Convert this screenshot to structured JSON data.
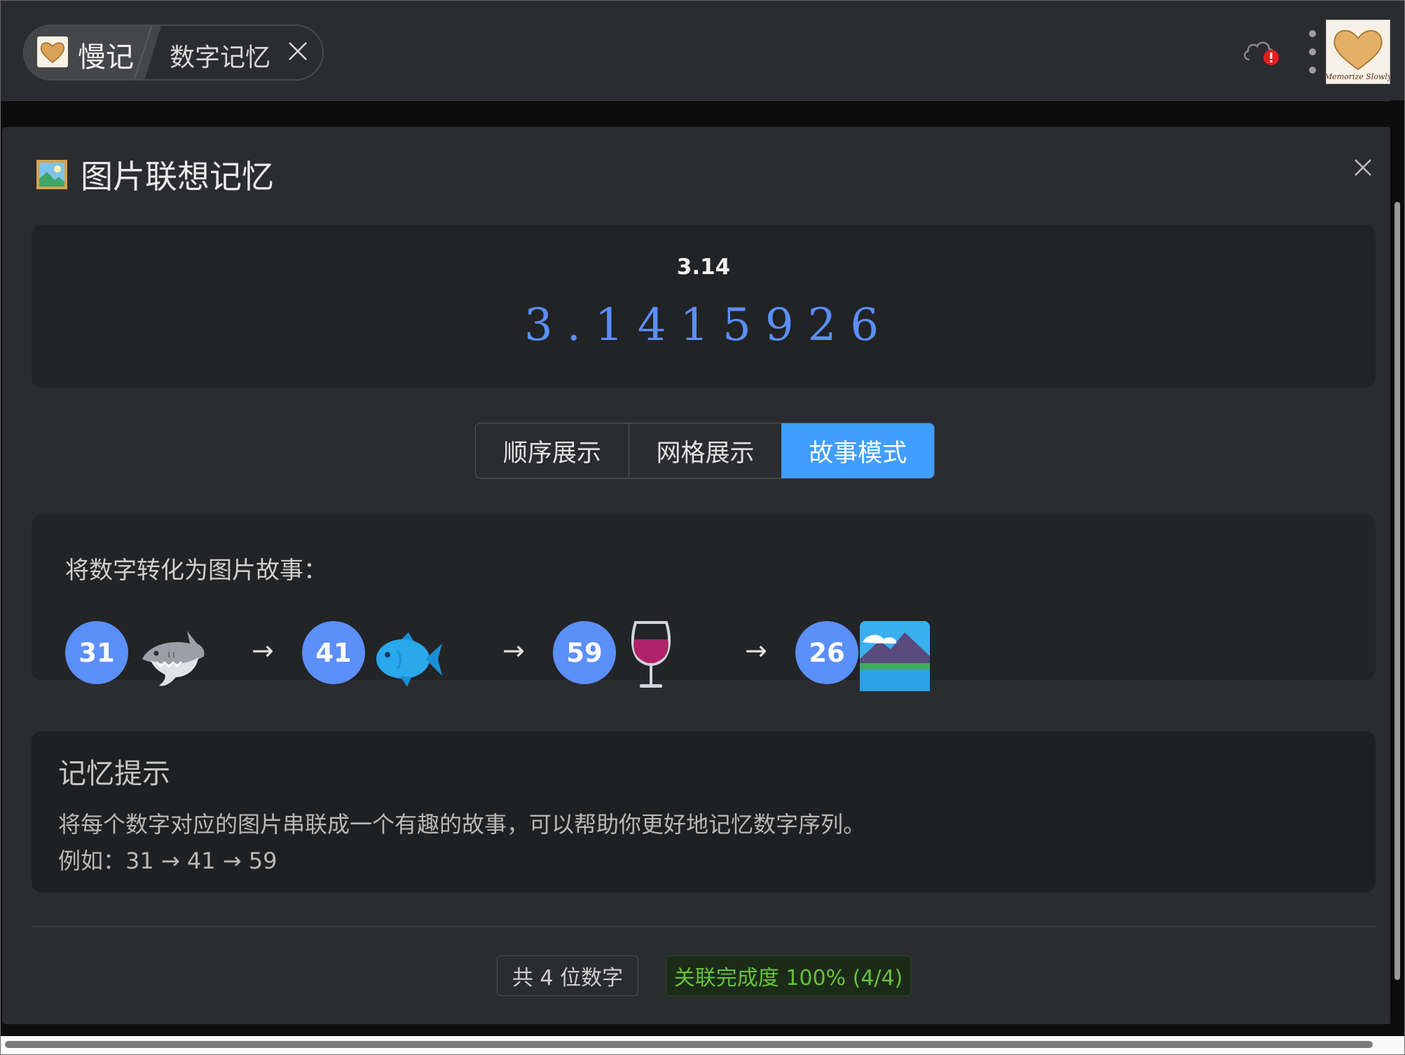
{
  "app": {
    "name": "慢记",
    "tab": {
      "label": "数字记忆"
    },
    "logo_text": "Memorize Slowly"
  },
  "dialog": {
    "title": "图片联想记忆",
    "number_card": {
      "name": "3.14",
      "digits": "3.1415926"
    },
    "view_modes": [
      {
        "label": "顺序展示",
        "active": false
      },
      {
        "label": "网格展示",
        "active": false
      },
      {
        "label": "故事模式",
        "active": true
      }
    ],
    "story": {
      "header": "将数字转化为图片故事：",
      "arrow": "→",
      "items": [
        {
          "number": "31",
          "icon": "shark-icon"
        },
        {
          "number": "41",
          "icon": "fish-icon"
        },
        {
          "number": "59",
          "icon": "wine-glass-icon"
        },
        {
          "number": "26",
          "icon": "landscape-icon"
        }
      ]
    },
    "tip": {
      "title": "记忆提示",
      "line1": "将每个数字对应的图片串联成一个有趣的故事，可以帮助你更好地记忆数字序列。",
      "line2": "例如：31 → 41 → 59"
    },
    "footer": {
      "count": "共 4 位数字",
      "progress": "关联完成度 100% (4/4)"
    }
  },
  "colors": {
    "accent": "#409eff",
    "number_circle": "#5b8ff9",
    "success": "#67c23a",
    "alert": "#e02020"
  }
}
